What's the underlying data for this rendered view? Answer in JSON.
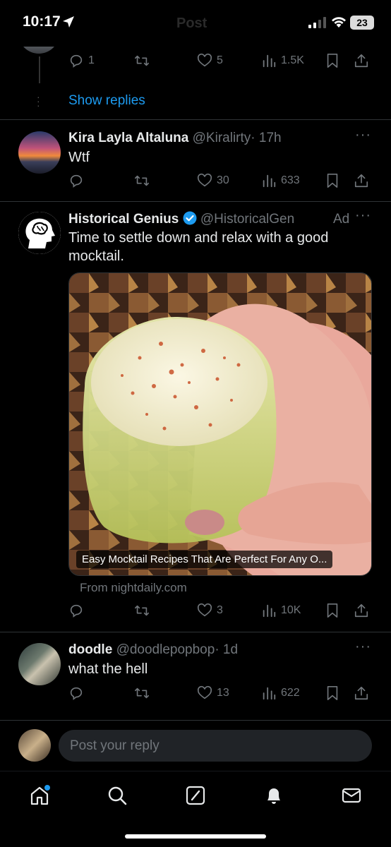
{
  "status_bar": {
    "time": "10:17",
    "header_title": "Post",
    "battery": "23"
  },
  "top_reply": {
    "actions": {
      "replies": "1",
      "reposts": "",
      "likes": "5",
      "views": "1.5K"
    },
    "show_replies": "Show replies"
  },
  "tweets": [
    {
      "name": "Kira Layla Altaluna",
      "handle": "@Kiralirty",
      "time": "· 17h",
      "text": "Wtf",
      "actions": {
        "replies": "",
        "reposts": "",
        "likes": "30",
        "views": "633"
      }
    },
    {
      "name": "Historical Genius",
      "handle": "@HistoricalGen",
      "ad_label": "Ad",
      "text": "Time to settle down and relax with a good mocktail.",
      "media_caption": "Easy Mocktail Recipes That Are Perfect For Any O...",
      "from": "From nightdaily.com",
      "actions": {
        "replies": "",
        "reposts": "",
        "likes": "3",
        "views": "10K"
      }
    },
    {
      "name": "doodle",
      "handle": "@doodlepopbop",
      "time": "· 1d",
      "text": "what the hell",
      "actions": {
        "replies": "",
        "reposts": "",
        "likes": "13",
        "views": "622"
      }
    }
  ],
  "reply_bar": {
    "placeholder": "Post your reply"
  },
  "colors": {
    "accent": "#1d9bf0",
    "muted": "#71767b",
    "background": "#000000"
  },
  "tabs": [
    "home-icon",
    "search-icon",
    "grok-icon",
    "notifications-icon",
    "messages-icon"
  ]
}
